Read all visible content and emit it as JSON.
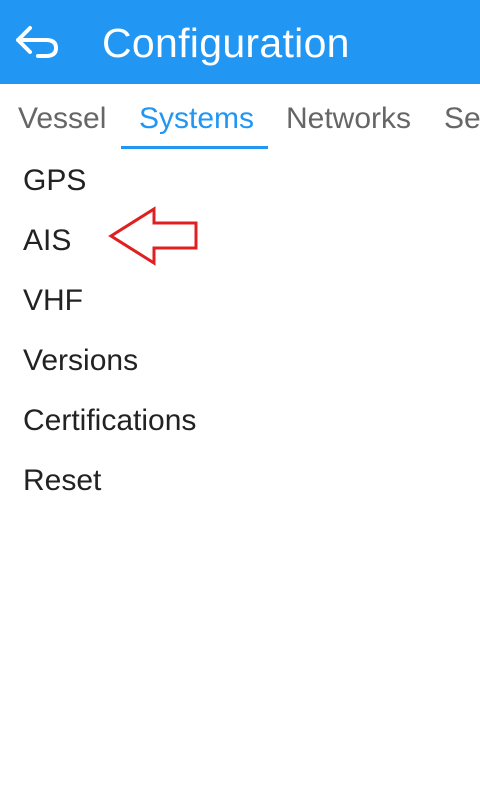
{
  "appbar": {
    "title": "Configuration",
    "back_icon": "back-arrow-icon",
    "color": "#2196f3"
  },
  "tabs": [
    {
      "label": "Vessel",
      "active": false
    },
    {
      "label": "Systems",
      "active": true
    },
    {
      "label": "Networks",
      "active": false
    },
    {
      "label": "Ser",
      "active": false
    }
  ],
  "list": {
    "items": [
      {
        "label": "GPS"
      },
      {
        "label": "AIS"
      },
      {
        "label": "VHF"
      },
      {
        "label": "Versions"
      },
      {
        "label": "Certifications"
      },
      {
        "label": "Reset"
      }
    ]
  },
  "annotation": {
    "icon": "left-arrow-outline-icon",
    "color": "#e02020"
  }
}
